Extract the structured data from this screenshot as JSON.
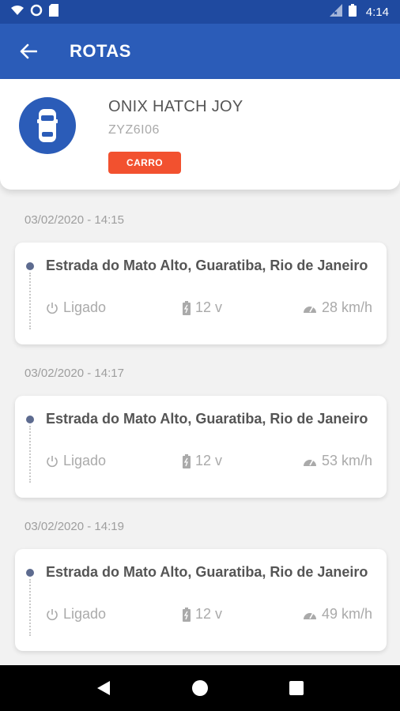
{
  "status_bar": {
    "time": "4:14"
  },
  "app_bar": {
    "title": "ROTAS"
  },
  "vehicle": {
    "name": "ONIX HATCH JOY",
    "plate": "ZYZ6I06",
    "type_badge": "CARRO",
    "badge_color": "#f2512f"
  },
  "colors": {
    "primary": "#2b5cb8",
    "status_bar": "#1f4aa0"
  },
  "routes": [
    {
      "timestamp": "03/02/2020 - 14:15",
      "address": "Estrada do Mato Alto, Guaratiba, Rio de Janeiro",
      "ignition": "Ligado",
      "voltage": "12 v",
      "speed": "28 km/h"
    },
    {
      "timestamp": "03/02/2020 - 14:17",
      "address": "Estrada do Mato Alto, Guaratiba, Rio de Janeiro",
      "ignition": "Ligado",
      "voltage": "12 v",
      "speed": "53 km/h"
    },
    {
      "timestamp": "03/02/2020 - 14:19",
      "address": "Estrada do Mato Alto, Guaratiba, Rio de Janeiro",
      "ignition": "Ligado",
      "voltage": "12 v",
      "speed": "49 km/h"
    }
  ],
  "icons": {
    "back": "arrow-left-icon",
    "vehicle": "car-icon",
    "ignition": "power-icon",
    "voltage": "battery-icon",
    "speed": "speedometer-icon"
  }
}
